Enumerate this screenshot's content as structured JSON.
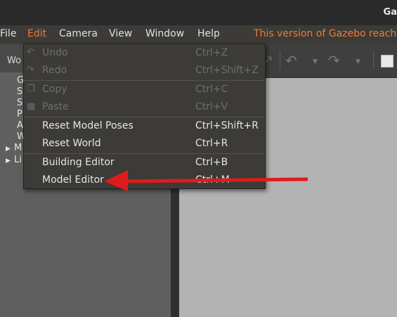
{
  "window": {
    "title": "Ga"
  },
  "menubar": {
    "items": [
      "File",
      "Edit",
      "Camera",
      "View",
      "Window",
      "Help"
    ],
    "notice": "This version of Gazebo reaches"
  },
  "left_panel": {
    "tab_label": "Wo",
    "tree": [
      {
        "label": "G",
        "expandable": false
      },
      {
        "label": "S",
        "expandable": false
      },
      {
        "label": "S",
        "expandable": false
      },
      {
        "label": "P",
        "expandable": false
      },
      {
        "label": "A",
        "expandable": false
      },
      {
        "label": "W",
        "expandable": false
      },
      {
        "label": "M",
        "expandable": true
      },
      {
        "label": "Li",
        "expandable": true
      }
    ]
  },
  "edit_menu": {
    "items": [
      {
        "label": "Undo",
        "shortcut": "Ctrl+Z",
        "icon": "undo-icon",
        "enabled": false
      },
      {
        "label": "Redo",
        "shortcut": "Ctrl+Shift+Z",
        "icon": "redo-icon",
        "enabled": false
      },
      {
        "label": "Copy",
        "shortcut": "Ctrl+C",
        "icon": "copy-icon",
        "enabled": false
      },
      {
        "label": "Paste",
        "shortcut": "Ctrl+V",
        "icon": "paste-icon",
        "enabled": false
      },
      {
        "label": "Reset Model Poses",
        "shortcut": "Ctrl+Shift+R",
        "enabled": true
      },
      {
        "label": "Reset World",
        "shortcut": "Ctrl+R",
        "enabled": true
      },
      {
        "label": "Building Editor",
        "shortcut": "Ctrl+B",
        "enabled": true
      },
      {
        "label": "Model Editor",
        "shortcut": "Ctrl+M",
        "enabled": true
      }
    ]
  },
  "toolbar": {
    "icons": [
      "maximize-icon",
      "undo-icon",
      "redo-icon",
      "box-shape-icon"
    ]
  },
  "colors": {
    "accent": "#f07a33",
    "arrow": "#e01b1b",
    "viewport": "#b3b3b3"
  }
}
